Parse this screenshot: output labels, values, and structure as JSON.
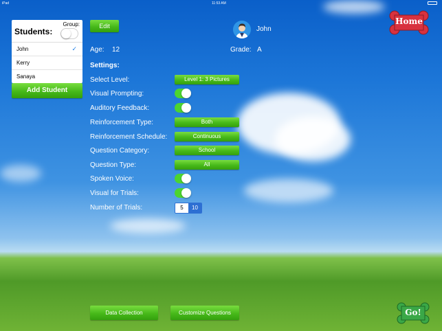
{
  "status_bar": {
    "carrier": "iPad",
    "time": "11:53 AM"
  },
  "students_panel": {
    "title": "Students:",
    "group_label": "Group:",
    "students": [
      "John",
      "Kerry",
      "Sanaya"
    ],
    "add_button": "Add Student"
  },
  "edit_button": "Edit",
  "profile": {
    "name": "John",
    "age_label": "Age:",
    "age": "12",
    "grade_label": "Grade:",
    "grade": "A"
  },
  "settings_title": "Settings:",
  "settings": {
    "select_level": {
      "label": "Select Level:",
      "value": "Level 1: 3 Pictures"
    },
    "visual_prompting": {
      "label": "Visual Prompting:"
    },
    "auditory_feedback": {
      "label": "Auditory Feedback:"
    },
    "reinforcement_type": {
      "label": "Reinforcement Type:",
      "value": "Both"
    },
    "reinforcement_schedule": {
      "label": "Reinforcement Schedule:",
      "value": "Continuous"
    },
    "question_category": {
      "label": "Question Category:",
      "value": "School"
    },
    "question_type": {
      "label": "Question Type:",
      "value": "All"
    },
    "spoken_voice": {
      "label": "Spoken Voice:"
    },
    "visual_for_trials": {
      "label": "Visual for Trials:"
    },
    "number_of_trials": {
      "label": "Number of Trials:",
      "options": [
        "5",
        "10"
      ],
      "selected": "10"
    }
  },
  "bottom_buttons": {
    "data_collection": "Data Collection",
    "customize_questions": "Customize Questions"
  },
  "home_button": "Home",
  "go_button": "Go!",
  "colors": {
    "accent_green": "#4cd52f",
    "button_green": "#47b91a",
    "selected_blue": "#2d6fd3",
    "bone_red": "#d8323f",
    "bone_green": "#3aa847"
  }
}
